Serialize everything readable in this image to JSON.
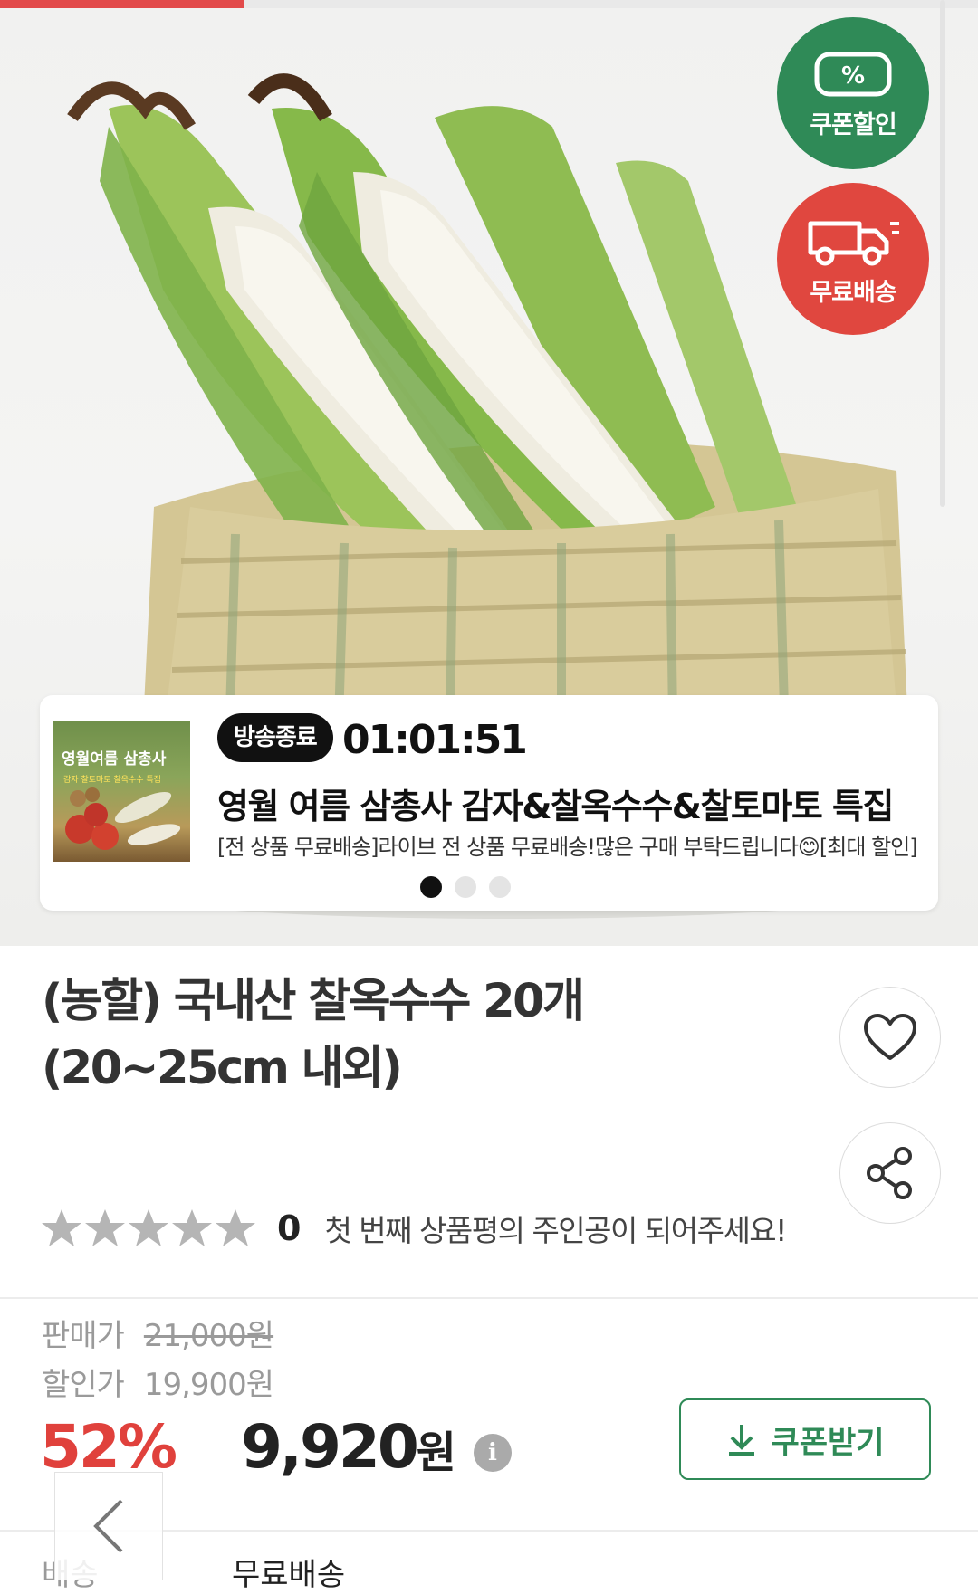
{
  "badges": {
    "coupon_label": "쿠폰할인",
    "coupon_symbol": "%",
    "free_shipping_label": "무료배송"
  },
  "live": {
    "status": "방송종료",
    "timer": "01:01:51",
    "title": "영월 여름 삼총사 감자&찰옥수수&찰토마토 특집",
    "description": "[전 상품 무료배송]라이브 전 상품 무료배송!많은 구매 부탁드립니다😊[최대 할인]",
    "thumb_title": "영월여름 삼총사",
    "thumb_subtitle": "감자 찰토마토 찰옥수수 특집",
    "slide_count": 3,
    "active_slide": 1
  },
  "product": {
    "title": "(농할) 국내산 찰옥수수 20개(20~25cm 내외)",
    "rating_count": "0",
    "rating_message": "첫 번째 상품평의 주인공이 되어주세요!",
    "rating_value": 0
  },
  "price": {
    "sale_label": "판매가",
    "sale_value": "21,000원",
    "discount_label": "할인가",
    "discount_value": "19,900원",
    "discount_percent": "52%",
    "final_price": "9,920",
    "final_unit": "원",
    "info_icon": "i",
    "coupon_button": "쿠폰받기"
  },
  "shipping": {
    "label": "배송",
    "value": "무료배송"
  },
  "colors": {
    "green": "#2f8a57",
    "red": "#e0473f",
    "discount_red": "#e0413c"
  }
}
